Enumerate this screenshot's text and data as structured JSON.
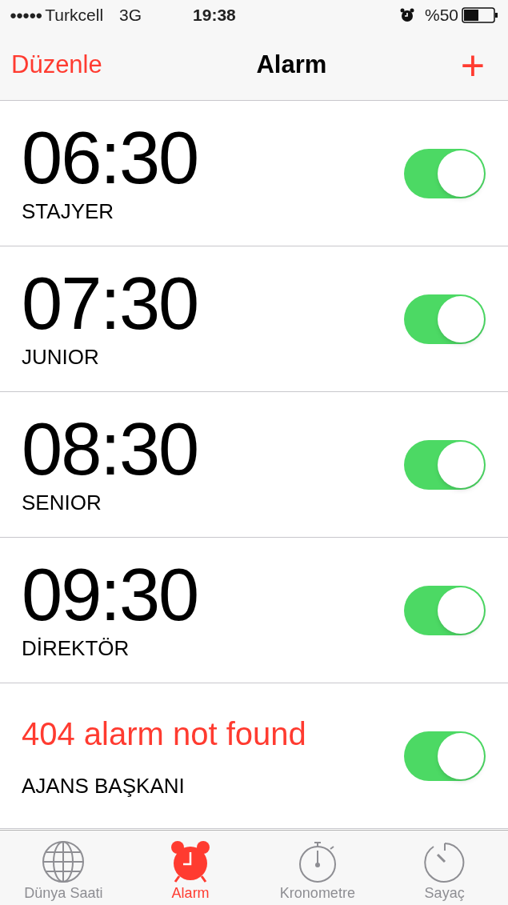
{
  "status_bar": {
    "signal_dots": "●●●●●",
    "carrier": "Turkcell",
    "network": "3G",
    "time": "19:38",
    "battery": "%50"
  },
  "nav": {
    "left": "Düzenle",
    "title": "Alarm",
    "right": "+"
  },
  "alarms": [
    {
      "kind": "time",
      "main": "06:30",
      "label": "STAJYER",
      "on": true
    },
    {
      "kind": "time",
      "main": "07:30",
      "label": "JUNIOR",
      "on": true
    },
    {
      "kind": "time",
      "main": "08:30",
      "label": "SENIOR",
      "on": true
    },
    {
      "kind": "time",
      "main": "09:30",
      "label": "DİREKTÖR",
      "on": true
    },
    {
      "kind": "note",
      "main": "404 alarm not found",
      "label": "AJANS BAŞKANI",
      "on": true
    }
  ],
  "tabs": [
    {
      "kind": "globe",
      "label": "Dünya Saati",
      "selected": false
    },
    {
      "kind": "alarm",
      "label": "Alarm",
      "selected": true
    },
    {
      "kind": "stopwatch",
      "label": "Kronometre",
      "selected": false
    },
    {
      "kind": "timer",
      "label": "Sayaç",
      "selected": false
    }
  ]
}
